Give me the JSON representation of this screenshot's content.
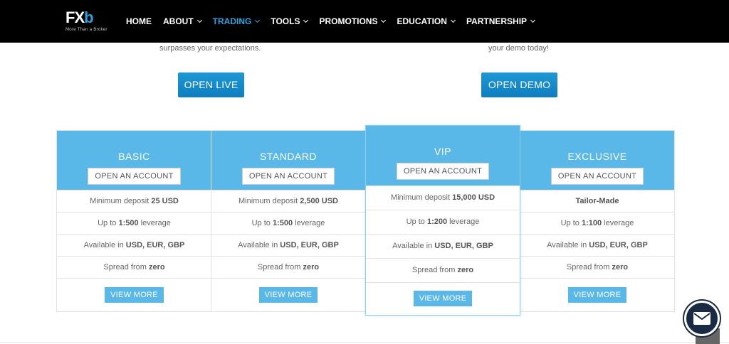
{
  "nav": {
    "logo_fx": "FX",
    "logo_b": "b",
    "logo_tagline": "More Than a Broker",
    "items": [
      {
        "label": "HOME",
        "dropdown": false,
        "active": false
      },
      {
        "label": "ABOUT",
        "dropdown": true,
        "active": false
      },
      {
        "label": "TRADING",
        "dropdown": true,
        "active": true
      },
      {
        "label": "TOOLS",
        "dropdown": true,
        "active": false
      },
      {
        "label": "PROMOTIONS",
        "dropdown": true,
        "active": false
      },
      {
        "label": "EDUCATION",
        "dropdown": true,
        "active": false
      },
      {
        "label": "PARTNERSHIP",
        "dropdown": true,
        "active": false
      }
    ]
  },
  "intro": {
    "left_text": "surpasses your expectations.",
    "right_text": "your demo today!",
    "live_button": "OPEN LIVE",
    "demo_button": "OPEN DEMO"
  },
  "plans": [
    {
      "name": "BASIC",
      "open_label": "OPEN AN ACCOUNT",
      "deposit_prefix": "Minimum deposit ",
      "deposit_value": "25 USD",
      "leverage_prefix": "Up to ",
      "leverage_value": "1:500",
      "leverage_suffix": " leverage",
      "currency_prefix": "Available in ",
      "currency_value": "USD, EUR, GBP",
      "spread_prefix": "Spread from ",
      "spread_value": "zero",
      "view_label": "VIEW MORE"
    },
    {
      "name": "STANDARD",
      "open_label": "OPEN AN ACCOUNT",
      "deposit_prefix": "Minimum deposit ",
      "deposit_value": "2,500 USD",
      "leverage_prefix": "Up to ",
      "leverage_value": "1:500",
      "leverage_suffix": " leverage",
      "currency_prefix": "Available in ",
      "currency_value": "USD, EUR, GBP",
      "spread_prefix": "Spread from ",
      "spread_value": "zero",
      "view_label": "VIEW MORE"
    },
    {
      "name": "VIP",
      "open_label": "OPEN AN ACCOUNT",
      "deposit_prefix": "Minimum deposit ",
      "deposit_value": "15,000 USD",
      "leverage_prefix": "Up to ",
      "leverage_value": "1:200",
      "leverage_suffix": " leverage",
      "currency_prefix": "Available in ",
      "currency_value": "USD, EUR, GBP",
      "spread_prefix": "Spread from ",
      "spread_value": "zero",
      "view_label": "VIEW MORE"
    },
    {
      "name": "EXCLUSIVE",
      "open_label": "OPEN AN ACCOUNT",
      "deposit_prefix": "",
      "deposit_value": "Tailor-Made",
      "leverage_prefix": "Up to ",
      "leverage_value": "1:100",
      "leverage_suffix": " leverage",
      "currency_prefix": "Available in ",
      "currency_value": "USD, EUR, GBP",
      "spread_prefix": "Spread from ",
      "spread_value": "zero",
      "view_label": "VIEW MORE"
    }
  ],
  "colors": {
    "nav_bg": "#000000",
    "accent": "#29a3e0",
    "plan_header": "#5ab8e9",
    "mail_bg": "#1a2a44"
  },
  "icons": {
    "mail": "envelope-icon",
    "dropdown": "chevron-down-icon"
  }
}
